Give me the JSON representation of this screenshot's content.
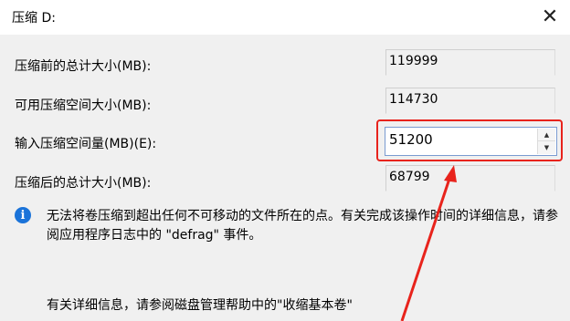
{
  "window": {
    "title": "压缩 D:",
    "close_glyph": "✕"
  },
  "fields": [
    {
      "label": "压缩前的总计大小(MB):",
      "value": "119999"
    },
    {
      "label": "可用压缩空间大小(MB):",
      "value": "114730"
    },
    {
      "label": "输入压缩空间量(MB)(E):",
      "value": "51200"
    },
    {
      "label": "压缩后的总计大小(MB):",
      "value": "68799"
    }
  ],
  "spinner": {
    "up_glyph": "▲",
    "down_glyph": "▼"
  },
  "info": {
    "icon": "info-icon",
    "icon_glyph": "i",
    "text": "无法将卷压缩到超出任何不可移动的文件所在的点。有关完成该操作时间的详细信息，请参阅应用程序日志中的 \"defrag\" 事件。"
  },
  "help_text": "有关详细信息，请参阅磁盘管理帮助中的\"收缩基本卷\"",
  "colors": {
    "highlight": "#e8231c",
    "info_icon": "#1a73d9"
  }
}
